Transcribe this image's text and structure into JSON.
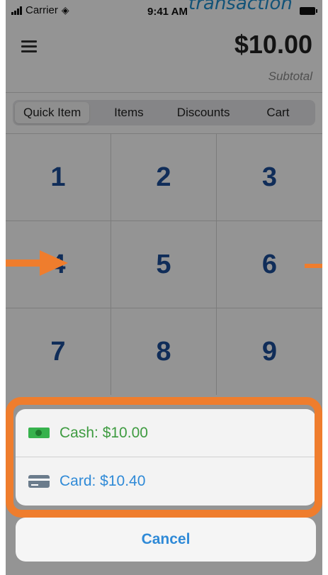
{
  "status_bar": {
    "carrier": "Carrier",
    "time": "9:41 AM"
  },
  "annotation": {
    "label": "transaction"
  },
  "header": {
    "amount": "$10.00",
    "subtotal_label": "Subtotal"
  },
  "tabs": [
    {
      "label": "Quick Item",
      "active": true
    },
    {
      "label": "Items"
    },
    {
      "label": "Discounts"
    },
    {
      "label": "Cart"
    }
  ],
  "keypad": {
    "keys": [
      "1",
      "2",
      "3",
      "4",
      "5",
      "6",
      "7",
      "8",
      "9"
    ]
  },
  "action_sheet": {
    "cash": {
      "label": "Cash: $10.00",
      "icon": "cash-icon"
    },
    "card": {
      "label": "Card: $10.40",
      "icon": "card-icon"
    },
    "cancel_label": "Cancel"
  },
  "colors": {
    "highlight": "#ef7d2d",
    "cash_text": "#3e9b40",
    "card_text": "#2f8ad7",
    "keypad_digits": "#1d4f99"
  }
}
